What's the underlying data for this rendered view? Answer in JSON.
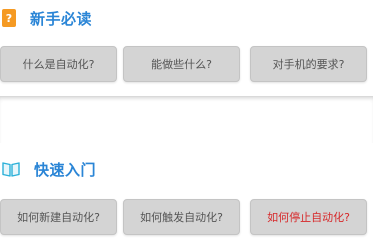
{
  "beginner_section": {
    "icon": "question-book-icon",
    "icon_glyph": "?",
    "title": "新手必读",
    "buttons": [
      {
        "label": "什么是自动化?"
      },
      {
        "label": "能做些什么?"
      },
      {
        "label": "对手机的要求?"
      }
    ]
  },
  "quickstart_section": {
    "icon": "open-book-icon",
    "title": "快速入门",
    "buttons": [
      {
        "label": "如何新建自动化?"
      },
      {
        "label": "如何触发自动化?"
      },
      {
        "label": "如何停止自动化?",
        "color": "#d7282a"
      }
    ]
  },
  "colors": {
    "accent": "#2a85d6",
    "guide_icon": "#f59a23",
    "button_bg": "#d4d4d4",
    "highlight_text": "#d7282a"
  }
}
